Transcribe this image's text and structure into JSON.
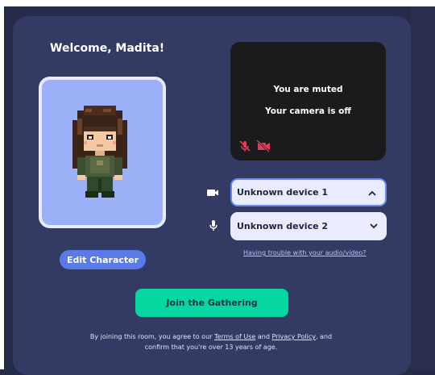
{
  "welcome": {
    "title": "Welcome, Madita!"
  },
  "avatar": {
    "edit_label": "Edit Character",
    "background": "#9bb0f6"
  },
  "video_preview": {
    "muted_text": "You are muted",
    "camera_text": "Your camera is off",
    "mic_icon": "mic-off-icon",
    "camera_icon": "video-off-icon",
    "indicator_color": "#e23b5a"
  },
  "devices": {
    "camera": {
      "icon": "video-camera-icon",
      "selected": "Unknown device 1",
      "state": "expanded"
    },
    "microphone": {
      "icon": "microphone-icon",
      "selected": "Unknown device 2",
      "state": "collapsed"
    }
  },
  "help_link": "Having trouble with your audio/video?",
  "join": {
    "label": "Join the Gathering",
    "color": "#06d6a0"
  },
  "legal": {
    "prefix": "By joining this room, you agree to our ",
    "terms_link": "Terms of Use",
    "mid": " and ",
    "privacy_link": "Privacy Policy",
    "suffix": ", and confirm that you're over 13 years of age."
  }
}
